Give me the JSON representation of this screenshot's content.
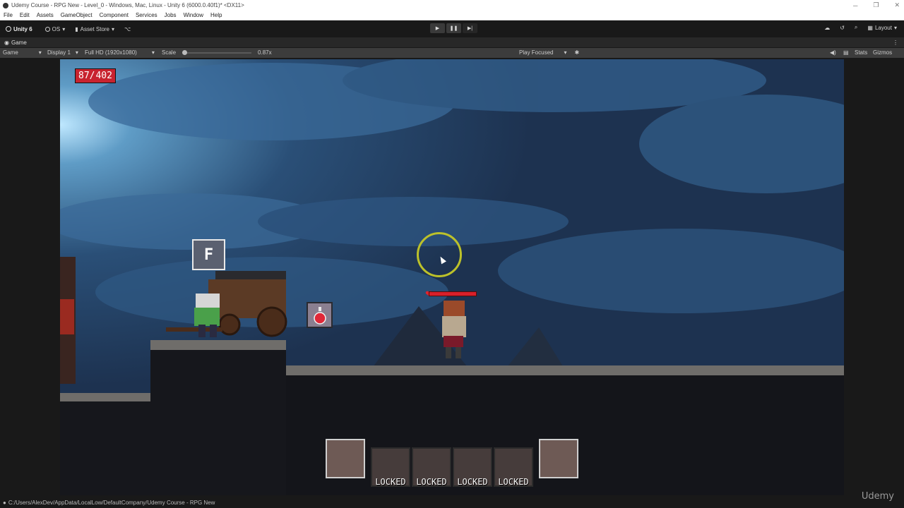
{
  "window": {
    "title": "Udemy Course - RPG New - Level_0 - Windows, Mac, Linux - Unity 6 (6000.0.40f1)* <DX11>",
    "controls": [
      "─",
      "❐",
      "✕"
    ]
  },
  "menu": [
    "File",
    "Edit",
    "Assets",
    "GameObject",
    "Component",
    "Services",
    "Jobs",
    "Window",
    "Help"
  ],
  "toolbar": {
    "unity_label": "Unity 6",
    "os_label": "OS",
    "asset_store_label": "Asset Store",
    "layout_label": "Layout"
  },
  "game_tab": {
    "label": "Game"
  },
  "game_options": {
    "view_mode": "Game",
    "display": "Display 1",
    "resolution": "Full HD (1920x1080)",
    "scale_label": "Scale",
    "scale_value": "0.87x",
    "play_mode": "Play Focused",
    "stats_label": "Stats",
    "gizmos_label": "Gizmos"
  },
  "hud": {
    "hp_current": "87/",
    "hp_total": "402",
    "interact_key": "F",
    "player_health_fraction": 1.0
  },
  "skill_slots": [
    {
      "state": "unlocked",
      "label": ""
    },
    {
      "state": "locked",
      "label": "LOCKED"
    },
    {
      "state": "locked",
      "label": "LOCKED"
    },
    {
      "state": "locked",
      "label": "LOCKED"
    },
    {
      "state": "locked",
      "label": "LOCKED"
    },
    {
      "state": "unlocked",
      "label": ""
    }
  ],
  "status": {
    "path": "C:/Users/AlexDev/AppData/LocalLow/DefaultCompany/Udemy Course - RPG New"
  },
  "watermark": "Udemy",
  "colors": {
    "editor_bg": "#191919",
    "hp_badge": "#c8232f",
    "cursor_ring": "#bcc12a",
    "sky": "#1e3452"
  }
}
